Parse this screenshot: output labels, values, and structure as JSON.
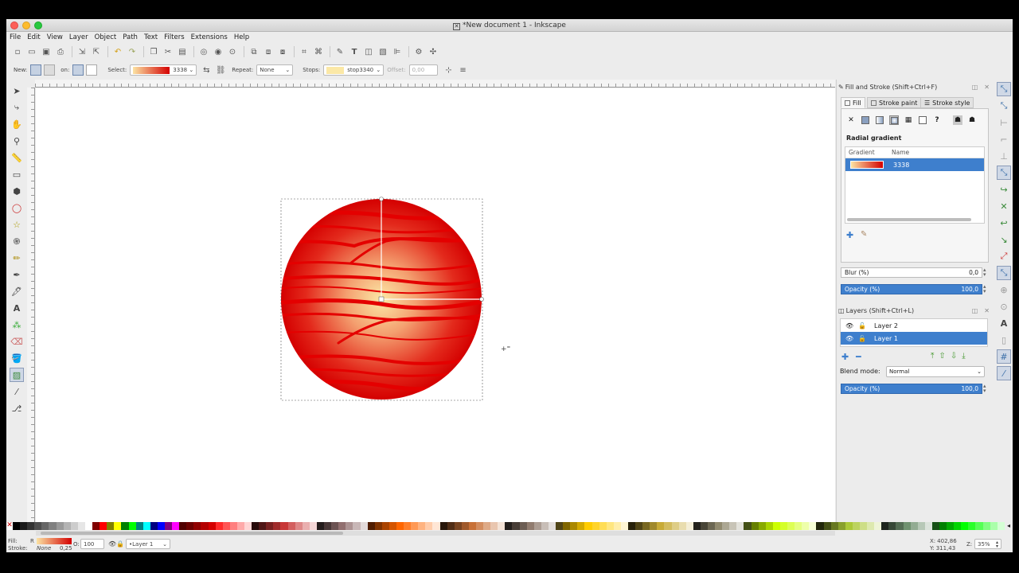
{
  "window": {
    "title": "*New document 1 - Inkscape",
    "title_icon": "x-app-icon"
  },
  "menu": [
    "File",
    "Edit",
    "View",
    "Layer",
    "Object",
    "Path",
    "Text",
    "Filters",
    "Extensions",
    "Help"
  ],
  "gradient_toolbar": {
    "new_label": "New:",
    "on_label": "on:",
    "select_label": "Select:",
    "select_value": "3338",
    "repeat_label": "Repeat:",
    "repeat_value": "None",
    "stops_label": "Stops:",
    "stops_value": "stop3340",
    "offset_label": "Offset:",
    "offset_value": "0,00"
  },
  "fill_stroke": {
    "title": "Fill and Stroke (Shift+Ctrl+F)",
    "tabs": [
      "Fill",
      "Stroke paint",
      "Stroke style"
    ],
    "mode_title": "Radial gradient",
    "columns": [
      "Gradient",
      "Name"
    ],
    "gradient_name": "3338",
    "blur_label": "Blur (%)",
    "blur_value": "0,0",
    "opacity_label": "Opacity (%)",
    "opacity_value": "100,0"
  },
  "layers": {
    "title": "Layers (Shift+Ctrl+L)",
    "items": [
      {
        "name": "Layer 2",
        "selected": false
      },
      {
        "name": "Layer 1",
        "selected": true
      }
    ],
    "blend_label": "Blend mode:",
    "blend_value": "Normal",
    "opacity_label": "Opacity (%)",
    "opacity_value": "100,0"
  },
  "status": {
    "fill_label": "Fill:",
    "fill_value": "R",
    "stroke_label": "Stroke:",
    "stroke_value": "None",
    "stroke_width": "0,25",
    "opacity_short": "O:",
    "opacity_value": "100",
    "layer_value": "•Layer 1",
    "x_label": "X:",
    "x_value": "402,86",
    "y_label": "Y:",
    "y_value": "311,43",
    "zoom_label": "Z:",
    "zoom_value": "35%"
  },
  "colors": {
    "accent": "#3e7fcd",
    "gradient_center": "#fbe8a6",
    "gradient_edge": "#d40000"
  },
  "palette": [
    "#000000",
    "#1a1a1a",
    "#333333",
    "#4d4d4d",
    "#666666",
    "#808080",
    "#999999",
    "#b3b3b3",
    "#cccccc",
    "#e6e6e6",
    "#ffffff",
    "#800000",
    "#ff0000",
    "#808000",
    "#ffff00",
    "#008000",
    "#00ff00",
    "#008080",
    "#00ffff",
    "#000080",
    "#0000ff",
    "#800080",
    "#ff00ff",
    "#500000",
    "#6c0000",
    "#900000",
    "#b40000",
    "#d40000",
    "#ff2a2a",
    "#ff5555",
    "#ff8080",
    "#ffaaaa",
    "#ffd5d5",
    "#280b0b",
    "#501616",
    "#782121",
    "#a02c2c",
    "#c83737",
    "#d35f5f",
    "#de8787",
    "#e9afaf",
    "#f4d7d7",
    "#241c1c",
    "#483737",
    "#6c5353",
    "#916f6f",
    "#ac9393",
    "#c8b7b7",
    "#e3dbdb",
    "#501d00",
    "#803300",
    "#aa4400",
    "#d45500",
    "#ff6600",
    "#ff7f2a",
    "#ff9955",
    "#ffb380",
    "#ffccaa",
    "#ffe6d5",
    "#28170b",
    "#502d16",
    "#784421",
    "#a05a2c",
    "#c87137",
    "#d38d5f",
    "#deaa87",
    "#e9c6af",
    "#f4e3d7",
    "#241f1c",
    "#483e37",
    "#6c5d53",
    "#917c6f",
    "#ac9d93",
    "#c8beb7",
    "#e3dedb",
    "#504416",
    "#806600",
    "#aa8800",
    "#d4aa00",
    "#ffcc00",
    "#ffd42a",
    "#ffdd55",
    "#ffe680",
    "#ffeeaa",
    "#fff6d5",
    "#28220b",
    "#504416",
    "#786721",
    "#a0892c",
    "#c8ab37",
    "#d3bc5f",
    "#decd87",
    "#e9ddaf",
    "#f4eed7",
    "#24221c",
    "#484537",
    "#6c6753",
    "#918a6f",
    "#aca793",
    "#c8c4b7",
    "#e3e2db",
    "#445016",
    "#668000",
    "#88aa00",
    "#aad400",
    "#ccff00",
    "#d4ff2a",
    "#ddff55",
    "#e5ff80",
    "#eeffaa",
    "#f6ffd5",
    "#22280b",
    "#445016",
    "#677821",
    "#89a02c",
    "#abc837",
    "#bcd35f",
    "#cdde87",
    "#dde9af",
    "#eef4d7",
    "#1c241c",
    "#374837",
    "#536c53",
    "#6f916f",
    "#93ac93",
    "#b7c8b7",
    "#dbe3db",
    "#165016",
    "#008000",
    "#00aa00",
    "#00d400",
    "#00ff00",
    "#2aff2a",
    "#55ff55",
    "#80ff80",
    "#aaffaa",
    "#d5ffd5"
  ]
}
